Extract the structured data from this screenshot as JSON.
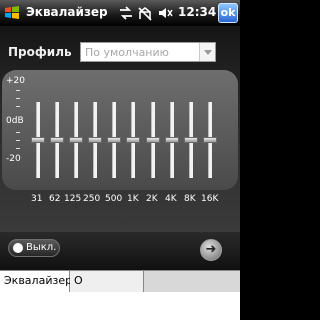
{
  "titlebar": {
    "title": "Эквалайзер",
    "clock": "12:34",
    "ok_label": "ok",
    "icons": [
      "windows-flag-icon",
      "connectivity-icon",
      "no-signal-icon",
      "volume-mute-icon"
    ]
  },
  "profile": {
    "label": "Профиль",
    "value": "По умолчанию"
  },
  "scale": {
    "top": "+20",
    "middle": "0dB",
    "bottom": "-20"
  },
  "bands": [
    "31",
    "62",
    "125",
    "250",
    "500",
    "1K",
    "2K",
    "4K",
    "8K",
    "16K"
  ],
  "band_levels_db": [
    0,
    0,
    0,
    0,
    0,
    0,
    0,
    0,
    0,
    0
  ],
  "controls": {
    "off_label": "Выкл."
  },
  "tabs": [
    {
      "label": "Эквалайзер",
      "active": true
    },
    {
      "label": "О программе",
      "active": false
    }
  ],
  "colors": {
    "ok_button": "#2a66d2",
    "panel": "#5a5a5a"
  }
}
